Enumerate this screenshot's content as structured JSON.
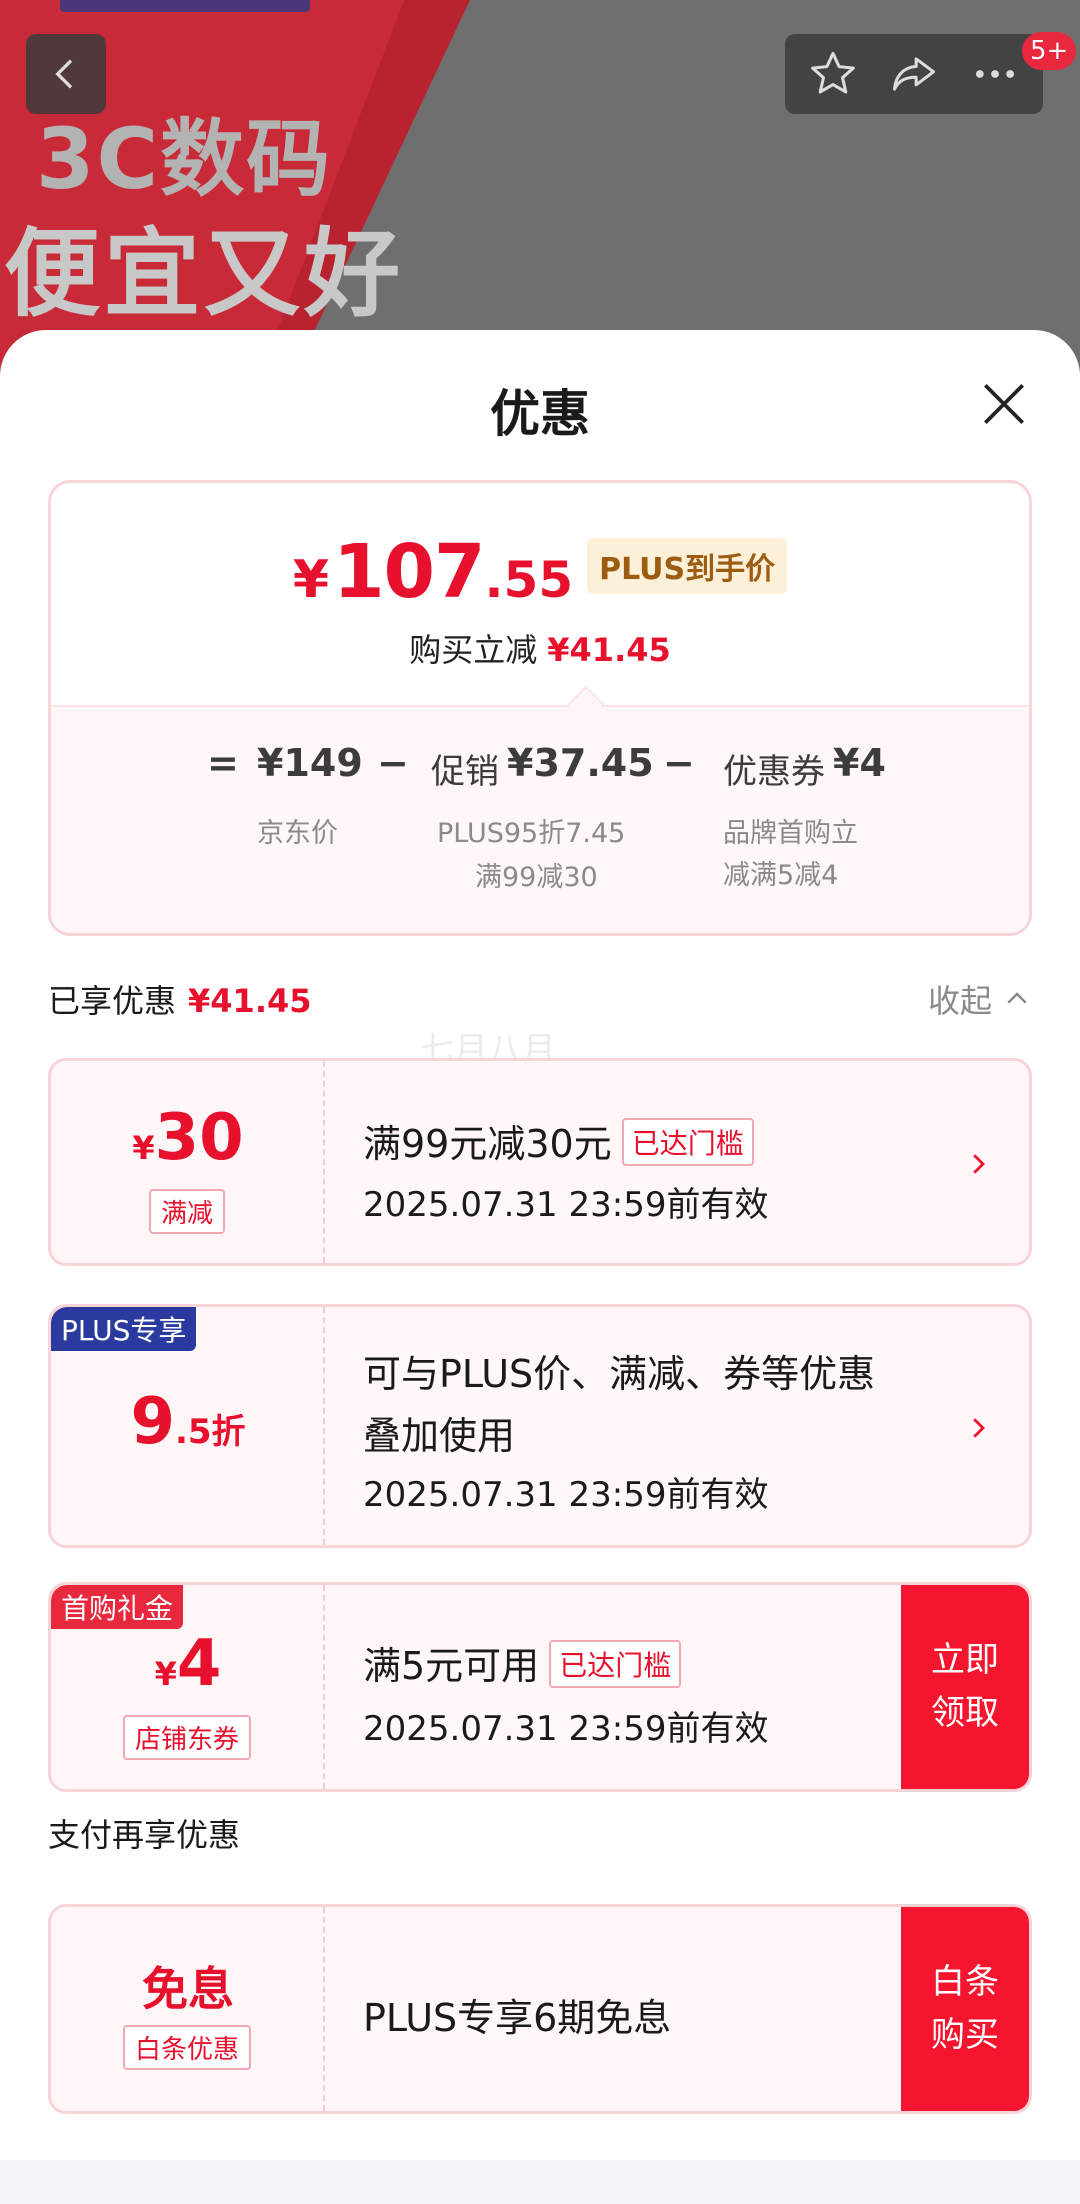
{
  "header": {
    "banner_line1": "3C数码",
    "banner_line2": "便宜又好",
    "badge": "5+",
    "icons": [
      "back-icon",
      "star-icon",
      "share-icon",
      "more-icon"
    ]
  },
  "sheet": {
    "title": "优惠",
    "close_icon": "close-icon"
  },
  "price": {
    "currency": "¥",
    "int": "107",
    "dec": ".55",
    "plus_tag": "PLUS到手价",
    "reduce_label": "购买立减",
    "reduce_value": "¥41.45"
  },
  "breakdown": {
    "equals": "=",
    "jd_price": "¥149",
    "minus1": "−",
    "promo_label": "促销",
    "promo_value": "¥37.45",
    "minus2": "−",
    "coupon_label": "优惠券",
    "coupon_value": "¥4",
    "jd_price_label": "京东价",
    "promo_detail1": "PLUS95折7.45",
    "promo_detail2": "满99减30",
    "coupon_detail1": "品牌首购立",
    "coupon_detail2": "减满5减4"
  },
  "enjoyed": {
    "label": "已享优惠",
    "value": "¥41.45",
    "collapse": "收起",
    "watermark": "七月八月"
  },
  "coupons": [
    {
      "symbol": "¥",
      "amount": "30",
      "tag": "满减",
      "title": "满99元减30元",
      "hint": "已达门槛",
      "date": "2025.07.31 23:59前有效"
    },
    {
      "corner": "PLUS专享",
      "amount_big": "9",
      "amount_small": ".5折",
      "title_line1": "可与PLUS价、满减、券等优惠",
      "title_line2": "叠加使用",
      "date": "2025.07.31 23:59前有效"
    },
    {
      "corner": "首购礼金",
      "symbol": "¥",
      "amount": "4",
      "tag": "店铺东券",
      "title": "满5元可用",
      "hint": "已达门槛",
      "date": "2025.07.31 23:59前有效",
      "button": "立即\n领取"
    }
  ],
  "pay": {
    "title": "支付再享优惠",
    "amount": "免息",
    "tag": "白条优惠",
    "text": "PLUS专享6期免息",
    "button": "白条\n购买"
  },
  "colors": {
    "accent": "#e8112d",
    "plus_blue": "#2a3a9e",
    "button_red": "#f5152f",
    "card_border": "#f7d4d8"
  }
}
